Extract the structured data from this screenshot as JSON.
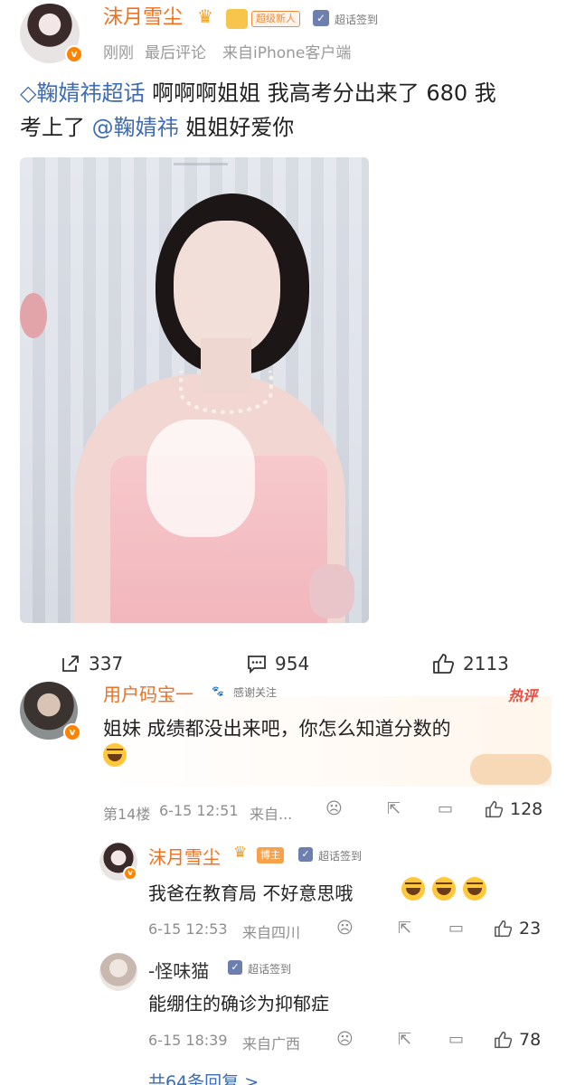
{
  "post": {
    "author": "沫月雪尘",
    "badge_level": "超级新人",
    "signin": "超话签到",
    "time": "刚刚",
    "meta_sep_1": "最后评论",
    "source": "来自iPhone客户端",
    "topic": "鞠婧祎超话",
    "text_part1": " 啊啊啊姐姐 我高考分出来了 680 我",
    "text_part2": "考上了",
    "mention": "@鞠婧祎",
    "text_part3": " 姐姐好爱你"
  },
  "actions": {
    "share_count": "337",
    "comment_count": "954",
    "like_count": "2113"
  },
  "comments": [
    {
      "name": "用户码宝一",
      "follow_label": "感谢关注",
      "hot_label": "热评",
      "text": "姐妹 成绩都没出来吧，你怎么知道分数的",
      "floor": "第14楼",
      "time": "6-15 12:51",
      "source": "来自...",
      "likes": "128"
    }
  ],
  "replies": [
    {
      "name": "沫月雪尘",
      "badge": "博主",
      "signin": "超话签到",
      "text": "我爸在教育局 不好意思哦",
      "time": "6-15 12:53",
      "source": "来自四川",
      "likes": "23"
    },
    {
      "name": "-怪味猫",
      "signin": "超话签到",
      "text": "能绷住的确诊为抑郁症",
      "time": "6-15 18:39",
      "source": "来自广西",
      "likes": "78"
    }
  ],
  "more_replies": "共64条回复 >"
}
